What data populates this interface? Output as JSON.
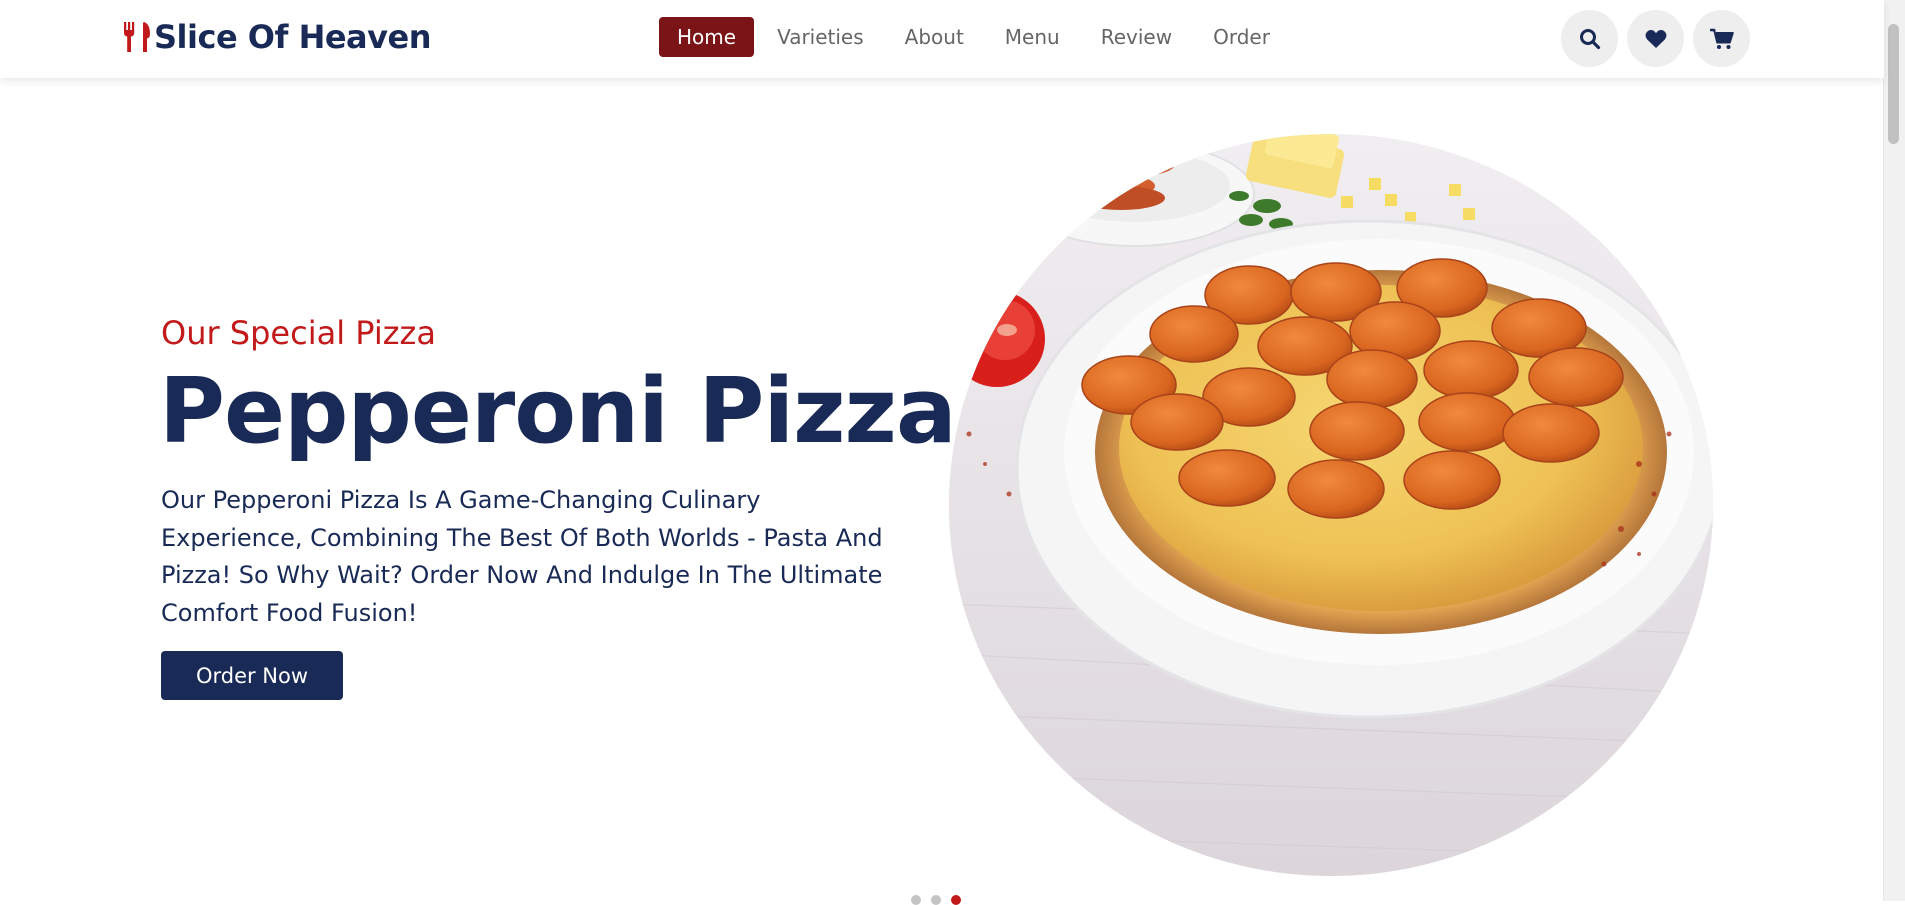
{
  "brand": {
    "name": "Slice Of Heaven",
    "icon": "utensils-icon"
  },
  "nav": {
    "items": [
      {
        "label": "Home",
        "active": true
      },
      {
        "label": "Varieties",
        "active": false
      },
      {
        "label": "About",
        "active": false
      },
      {
        "label": "Menu",
        "active": false
      },
      {
        "label": "Review",
        "active": false
      },
      {
        "label": "Order",
        "active": false
      }
    ],
    "icons": [
      "search-icon",
      "heart-icon",
      "cart-icon"
    ]
  },
  "hero": {
    "subtitle": "Our Special Pizza",
    "title": "Pepperoni Pizza",
    "description": "Our Pepperoni Pizza Is A Game-Changing Culinary Experience, Combining The Best Of Both Worlds - Pasta And Pizza! So Why Wait? Order Now And Indulge In The Ultimate Comfort Food Fusion!",
    "button_label": "Order Now",
    "image": "pepperoni-pizza-photo"
  },
  "slider": {
    "total": 3,
    "active_index": 3
  },
  "colors": {
    "navy": "#192a56",
    "accent_red": "#c21a1a",
    "active_nav_bg": "#7b1416",
    "icon_bg": "#eeeeee"
  }
}
